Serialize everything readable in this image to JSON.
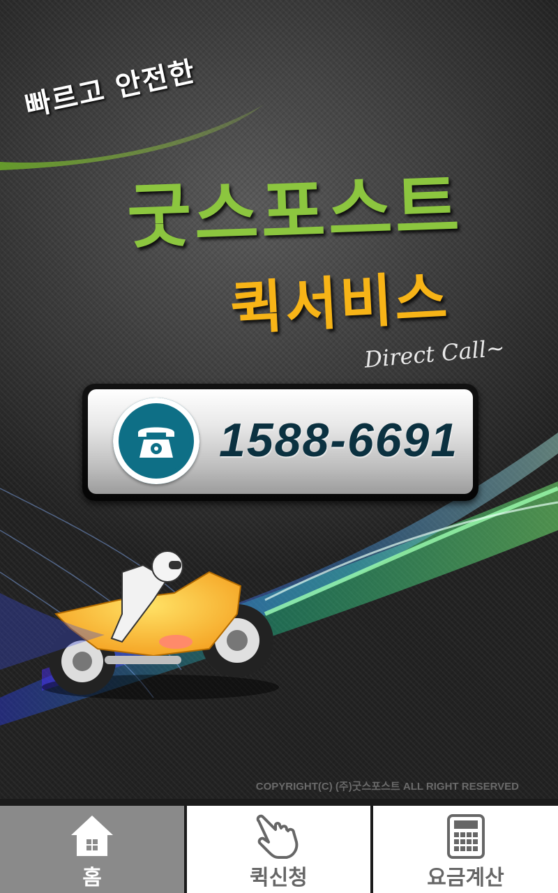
{
  "hero": {
    "tagline": "빠르고 안전한",
    "brand": "굿스포스트",
    "service": "퀵서비스",
    "direct_call": "Direct Call~",
    "phone_number": "1588-6691",
    "copyright": "COPYRIGHT(C) (주)굿스포스트  ALL RIGHT RESERVED"
  },
  "colors": {
    "brand_green": "#8cc63f",
    "service_orange": "#f7b417",
    "phone_teal": "#0e6f86",
    "active_tab": "#8a8a8a"
  },
  "nav": {
    "tabs": [
      {
        "label": "홈",
        "icon": "home-icon",
        "active": true
      },
      {
        "label": "퀵신청",
        "icon": "hand-pointer-icon",
        "active": false
      },
      {
        "label": "요금계산",
        "icon": "calculator-icon",
        "active": false
      }
    ]
  }
}
